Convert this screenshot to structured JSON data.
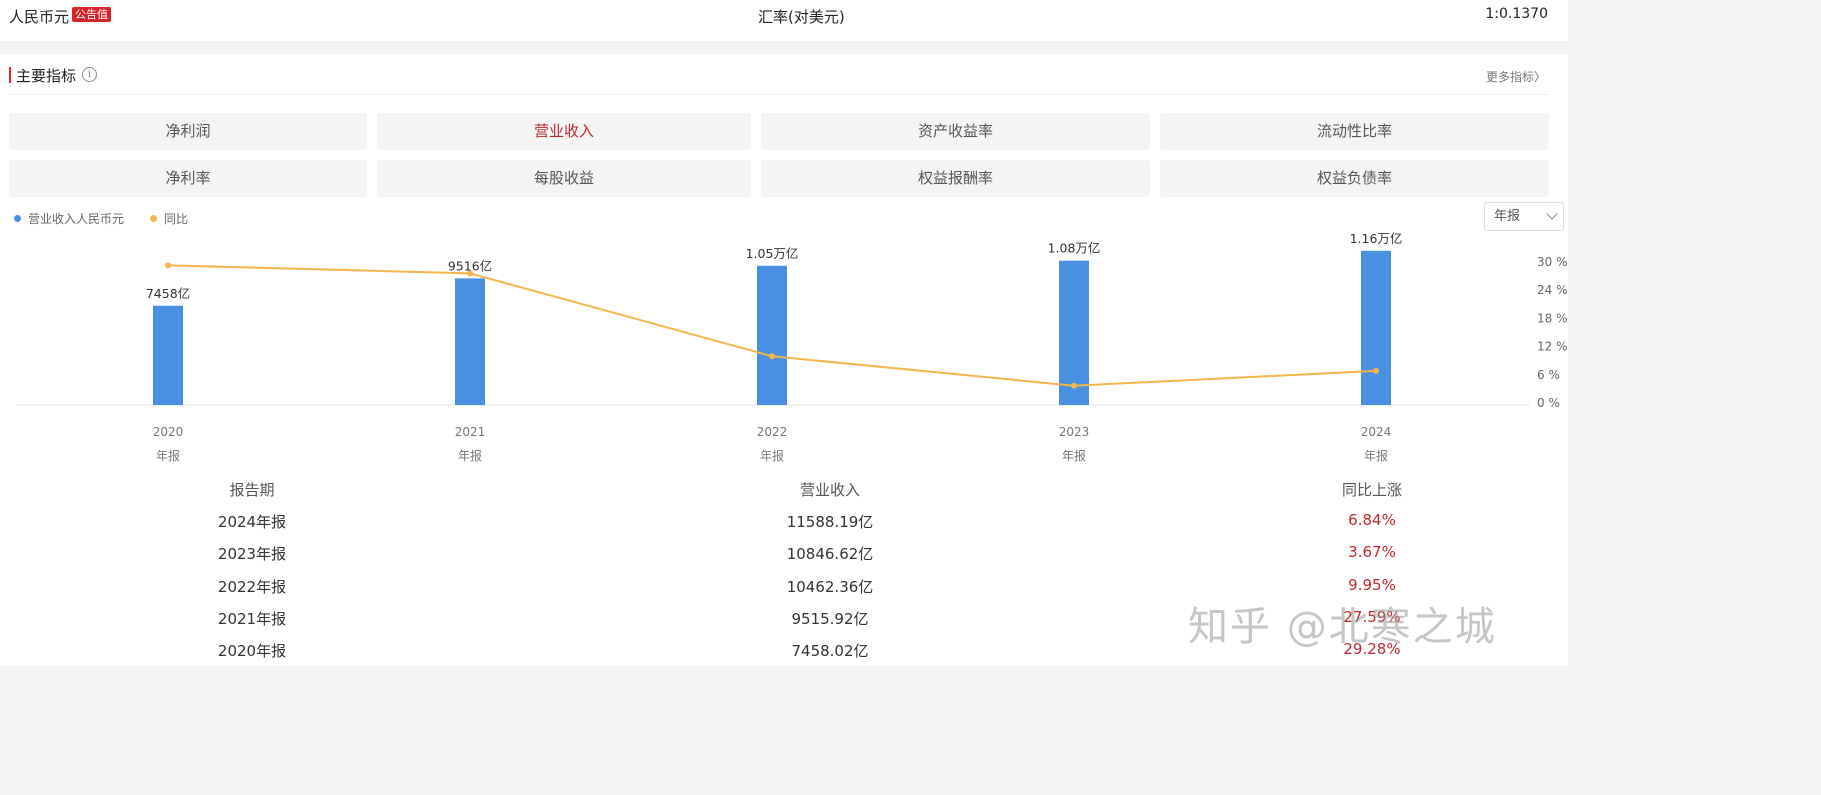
{
  "topbar": {
    "currency": "人民币元",
    "badge": "公告值",
    "fx_label": "汇率(对美元)",
    "fx_value": "1:0.1370"
  },
  "section": {
    "title": "主要指标",
    "info_icon": "info-icon",
    "more_link": "更多指标〉"
  },
  "tabs": [
    {
      "label": "净利润",
      "active": false
    },
    {
      "label": "营业收入",
      "active": true
    },
    {
      "label": "资产收益率",
      "active": false
    },
    {
      "label": "流动性比率",
      "active": false
    },
    {
      "label": "净利率",
      "active": false
    },
    {
      "label": "每股收益",
      "active": false
    },
    {
      "label": "权益报酬率",
      "active": false
    },
    {
      "label": "权益负债率",
      "active": false
    }
  ],
  "legend": {
    "series1": "营业收入人民币元",
    "series2": "同比"
  },
  "period_select": {
    "value": "年报"
  },
  "colors": {
    "accent": "#c0272d",
    "bar": "#4a90e2",
    "line": "#f4b54a"
  },
  "chart_data": {
    "type": "bar",
    "categories": [
      "2020",
      "2021",
      "2022",
      "2023",
      "2024"
    ],
    "category_sublabel": "年报",
    "series": [
      {
        "name": "营业收入人民币元",
        "type": "bar",
        "axis": "left",
        "values": [
          7458.02,
          9515.92,
          10462.36,
          10846.62,
          11588.19
        ],
        "labels": [
          "7458亿",
          "9516亿",
          "1.05万亿",
          "1.08万亿",
          "1.16万亿"
        ]
      },
      {
        "name": "同比",
        "type": "line",
        "axis": "right",
        "values": [
          29.28,
          27.59,
          9.95,
          3.67,
          6.84
        ]
      }
    ],
    "y_right_ticks": [
      "30 %",
      "24 %",
      "18 %",
      "12 %",
      "6 %",
      "0 %"
    ],
    "y_right_range": [
      0,
      30
    ],
    "legend_position": "top-left",
    "grid": false
  },
  "table": {
    "headers": [
      "报告期",
      "营业收入",
      "同比上涨"
    ],
    "rows": [
      [
        "2024年报",
        "11588.19亿",
        "6.84%"
      ],
      [
        "2023年报",
        "10846.62亿",
        "3.67%"
      ],
      [
        "2022年报",
        "10462.36亿",
        "9.95%"
      ],
      [
        "2021年报",
        "9515.92亿",
        "27.59%"
      ],
      [
        "2020年报",
        "7458.02亿",
        "29.28%"
      ]
    ]
  },
  "watermark": "知乎 @北寒之城"
}
